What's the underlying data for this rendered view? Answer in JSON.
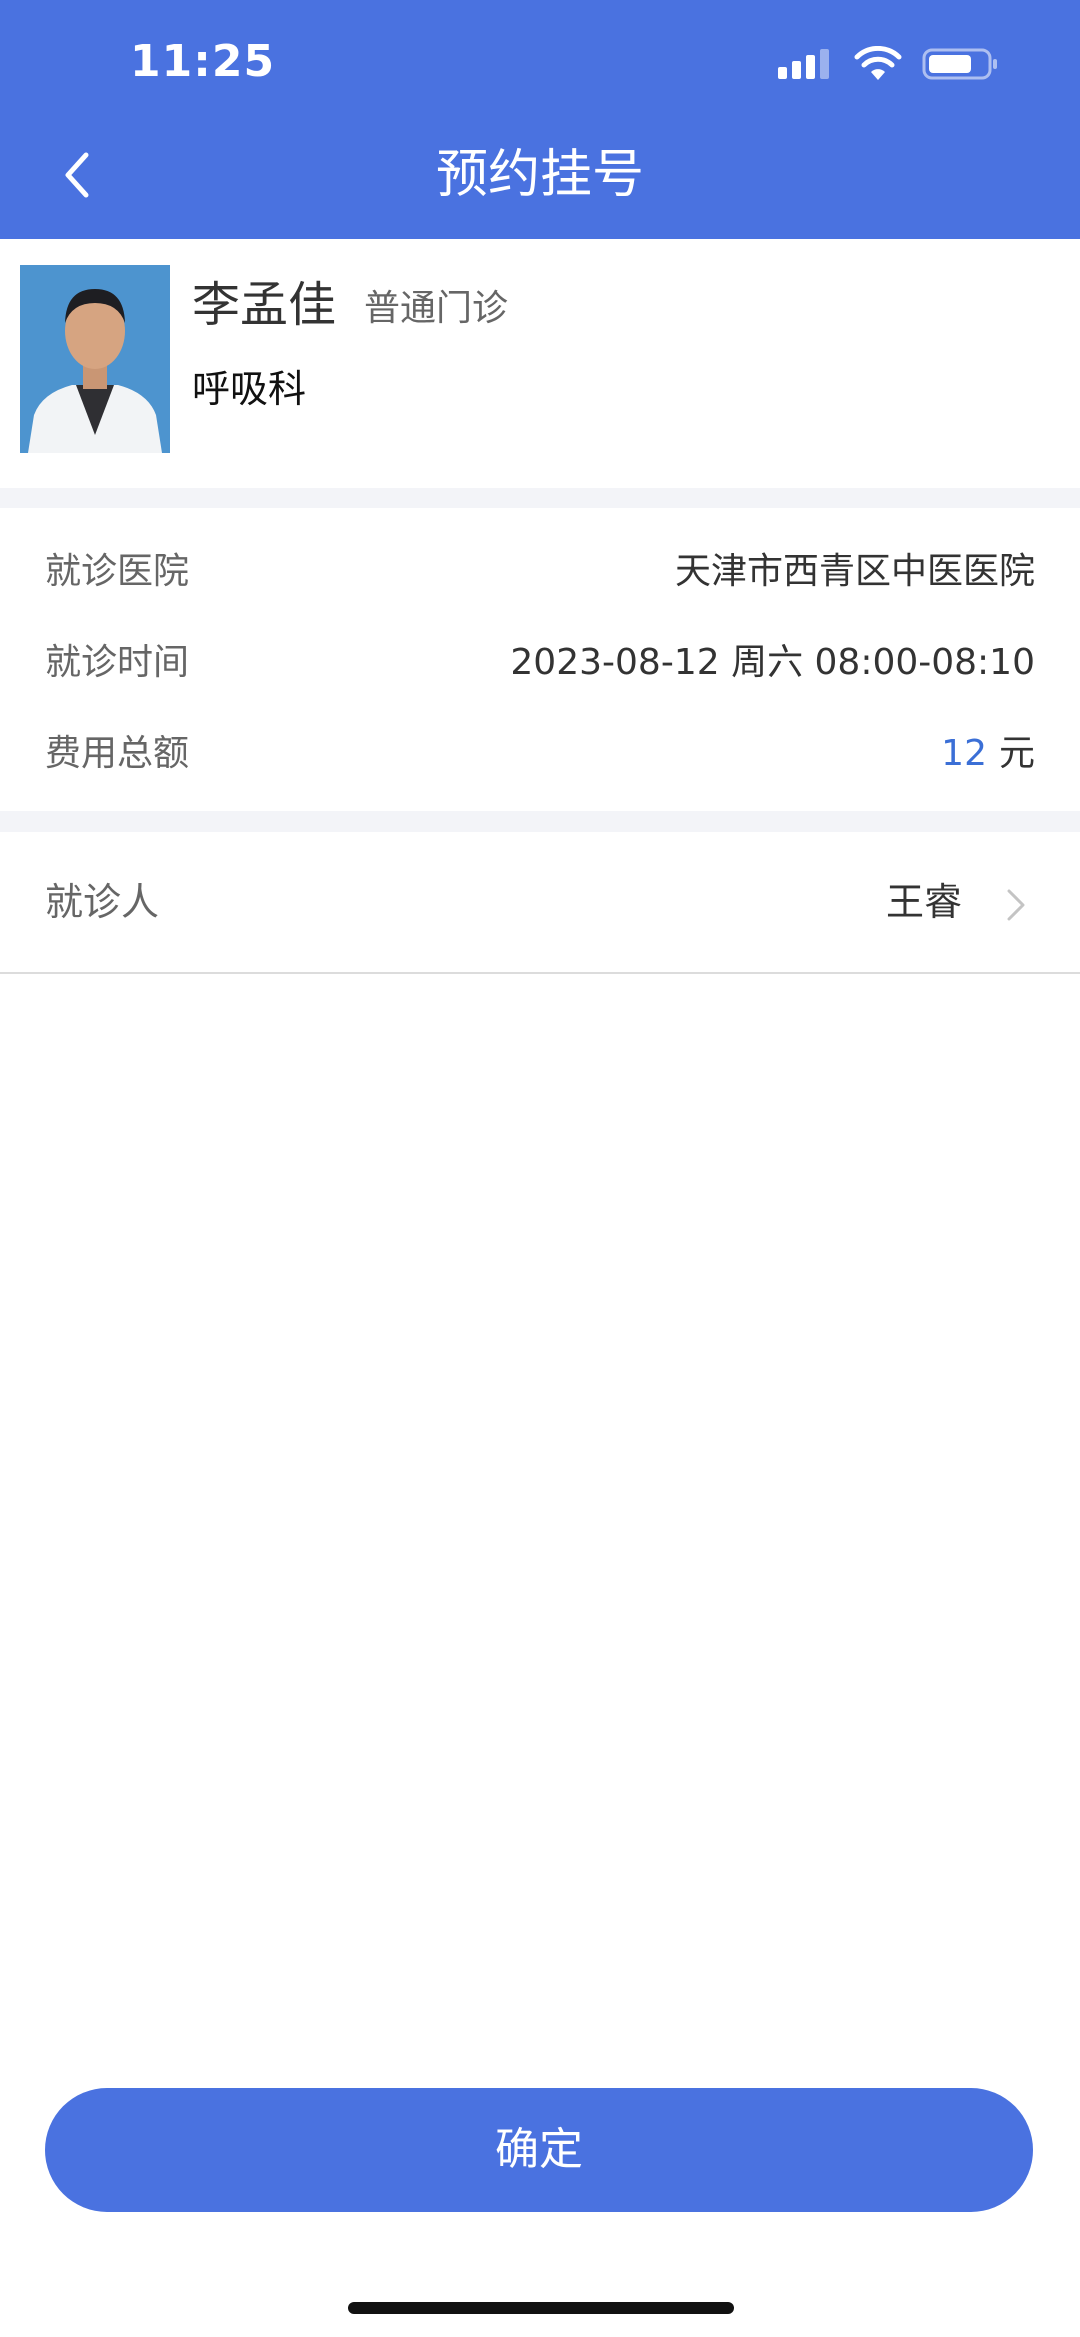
{
  "status_bar": {
    "time": "11:25"
  },
  "nav": {
    "title": "预约挂号"
  },
  "doctor": {
    "name": "李孟佳",
    "clinic_type": "普通门诊",
    "department": "呼吸科"
  },
  "appointment": {
    "hospital_label": "就诊医院",
    "hospital_value": "天津市西青区中医医院",
    "time_label": "就诊时间",
    "time_value": "2023-08-12 周六 08:00-08:10",
    "fee_label": "费用总额",
    "fee_amount": "12",
    "fee_unit": "元"
  },
  "patient": {
    "label": "就诊人",
    "value": "王睿"
  },
  "confirm_label": "确定",
  "colors": {
    "primary": "#4a72e0",
    "fee_accent": "#3b6fd6",
    "section_gap": "#f3f4f8"
  }
}
